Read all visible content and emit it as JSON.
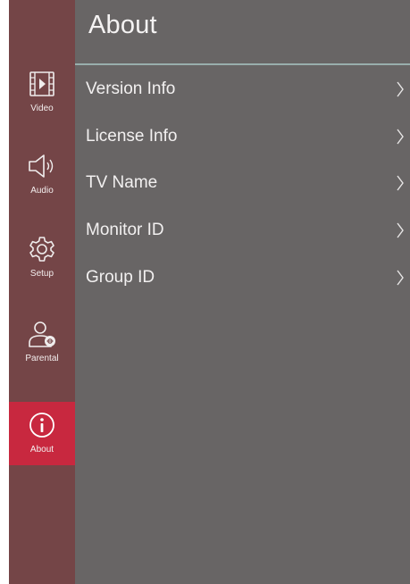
{
  "page": {
    "title": "About"
  },
  "sidebar": {
    "items": [
      {
        "label": "Video",
        "icon": "video-icon",
        "active": false
      },
      {
        "label": "Audio",
        "icon": "speaker-icon",
        "active": false
      },
      {
        "label": "Setup",
        "icon": "gear-icon",
        "active": false
      },
      {
        "label": "Parental",
        "icon": "parental-user-icon",
        "active": false
      },
      {
        "label": "About",
        "icon": "info-icon",
        "active": true
      }
    ]
  },
  "menu": {
    "items": [
      {
        "label": "Version Info"
      },
      {
        "label": "License Info"
      },
      {
        "label": "TV Name"
      },
      {
        "label": "Monitor ID"
      },
      {
        "label": "Group ID"
      }
    ]
  },
  "colors": {
    "background": "#686565",
    "sidebar": "#744547",
    "active_accent": "#c8283f",
    "divider": "#98aeac",
    "text": "#f2f0f0"
  }
}
